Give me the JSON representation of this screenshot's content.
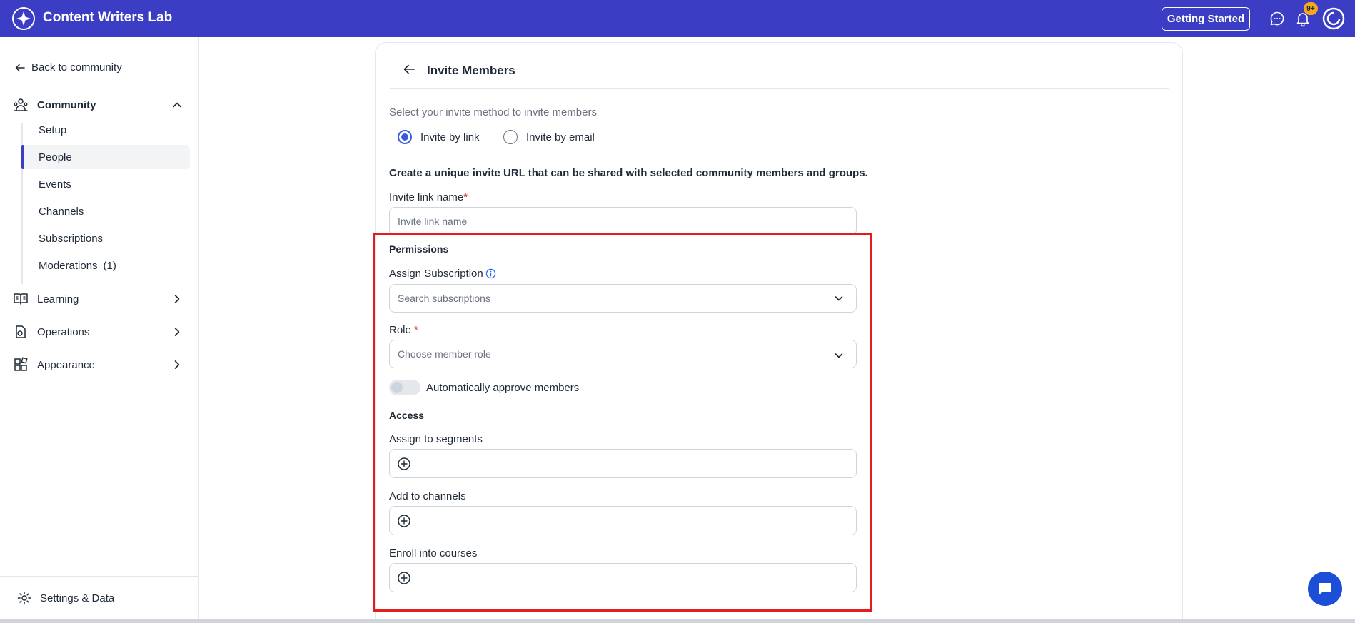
{
  "topbar": {
    "brand_name": "Content Writers Lab",
    "getting_started_label": "Getting Started",
    "notification_badge": "9+",
    "accent_color": "#3b3dc4"
  },
  "sidebar": {
    "back_label": "Back to community",
    "community_label": "Community",
    "subnav": [
      {
        "label": "Setup"
      },
      {
        "label": "People"
      },
      {
        "label": "Events"
      },
      {
        "label": "Channels"
      },
      {
        "label": "Subscriptions"
      },
      {
        "label": "Moderations",
        "count": "(1)"
      }
    ],
    "sections": [
      {
        "label": "Learning",
        "icon": "book-icon"
      },
      {
        "label": "Operations",
        "icon": "operations-icon"
      },
      {
        "label": "Appearance",
        "icon": "appearance-icon"
      }
    ],
    "settings_label": "Settings & Data"
  },
  "main": {
    "title": "Invite Members",
    "invite_method_prompt": "Select your invite method to invite members",
    "radio_link_label": "Invite by link",
    "radio_email_label": "Invite by email",
    "description": "Create a unique invite URL that can be shared with selected community members and groups.",
    "invite_link_name_label": "Invite link name",
    "required_mark": "*",
    "invite_link_name_placeholder": "Invite link name",
    "permissions_heading": "Permissions",
    "assign_subscription_label": "Assign Subscription",
    "subscription_placeholder": "Search subscriptions",
    "role_label": "Role",
    "role_placeholder": "Choose member role",
    "auto_approve_label": "Automatically approve members",
    "access_heading": "Access",
    "segments_label": "Assign to segments",
    "channels_label": "Add to channels",
    "courses_label": "Enroll into courses"
  }
}
